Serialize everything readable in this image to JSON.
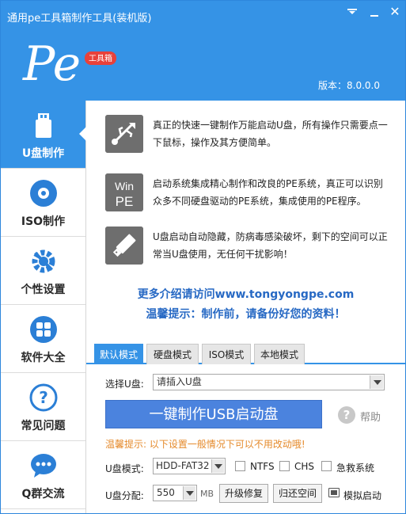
{
  "window": {
    "title": "通用pe工具箱制作工具(装机版)"
  },
  "logo": {
    "text": "Pe",
    "badge": "工具箱"
  },
  "version": "版本：8.0.0.0",
  "sidebar": {
    "items": [
      {
        "label": "U盘制作",
        "active": true
      },
      {
        "label": "ISO制作",
        "active": false
      },
      {
        "label": "个性设置",
        "active": false
      },
      {
        "label": "软件大全",
        "active": false
      },
      {
        "label": "常见问题",
        "active": false
      },
      {
        "label": "Q群交流",
        "active": false
      }
    ]
  },
  "features": [
    {
      "text": "真正的快速一键制作万能启动U盘，所有操作只需要点一下鼠标，操作及其方便简单。"
    },
    {
      "icon_text_1": "Win",
      "icon_text_2": "PE",
      "text": "启动系统集成精心制作和改良的PE系统，真正可以识别众多不同硬盘驱动的PE系统，集成使用的PE程序。"
    },
    {
      "text": "U盘启动自动隐藏，防病毒感染破坏，剩下的空间可以正常当U盘使用，无任何干扰影响！"
    }
  ],
  "more_link": "更多介绍请访问www.tongyongpe.com",
  "warm_tip": "温馨提示：制作前，请备份好您的资料！",
  "tabs": [
    {
      "label": "默认模式",
      "active": true
    },
    {
      "label": "硬盘模式",
      "active": false
    },
    {
      "label": "ISO模式",
      "active": false
    },
    {
      "label": "本地模式",
      "active": false
    }
  ],
  "form": {
    "select_label": "选择U盘:",
    "select_value": "请插入U盘",
    "make_button": "一键制作USB启动盘",
    "help_label": "帮助",
    "orange_tip": "温馨提示: 以下设置一般情况下可以不用改动哦!",
    "mode_label": "U盘模式:",
    "mode_value": "HDD-FAT32",
    "ntfs": "NTFS",
    "chs": "CHS",
    "rescue": "急救系统",
    "partition_label": "U盘分配:",
    "partition_value": "550",
    "partition_unit": "MB",
    "upgrade_button": "升级修复",
    "restore_button": "归还空间",
    "simulate_label": "模拟启动"
  },
  "colors": {
    "accent": "#3593e6",
    "link": "#2769c4",
    "tip": "#e58a2b",
    "logo_badge": "#e8413a"
  }
}
